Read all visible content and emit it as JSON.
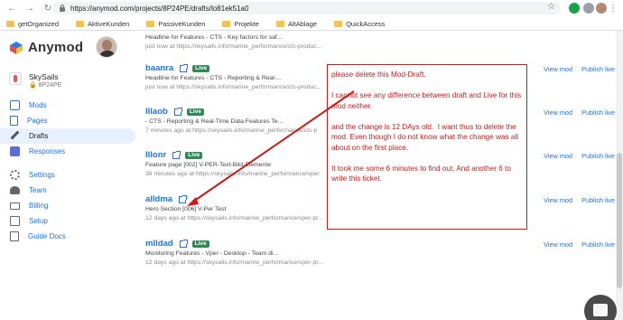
{
  "browser": {
    "url": "https://anymod.com/projects/8P24PE/drafts/lo81ek51a0",
    "bookmarks": [
      "getOrganized",
      "AktiveKunden",
      "PassiveKunden",
      "Projekte",
      "AltAblage",
      "QuickAccess"
    ]
  },
  "brand": {
    "name": "Anymod"
  },
  "project": {
    "name": "SkySails",
    "id": "8P24PE"
  },
  "menu": {
    "mods": "Mods",
    "pages": "Pages",
    "drafts": "Drafts",
    "responses": "Responses",
    "settings": "Settings",
    "team": "Team",
    "billing": "Billing",
    "setup": "Setup",
    "guide_docs": "Guide Docs"
  },
  "drafts": [
    {
      "name": "",
      "desc": "Headline for Features - CTS - Key factors for saf...",
      "meta": "just now at https://skysails.info/marine_performance/cts-produc...",
      "live": false
    },
    {
      "name": "baanra",
      "desc": "Headline for Features - CTS - Reporting & Real-...",
      "meta": "just now at https://skysails.info/marine_performance/cts-produc...",
      "live": true
    },
    {
      "name": "lllaob",
      "desc": "- CTS - Reporting & Real-Time Data Features Te...",
      "meta": "7 minutes ago at https://skysails.info/marine_performance/cts-p",
      "live": true
    },
    {
      "name": "lllonr",
      "desc": "Feature page [002] V-PER-Text-Bild-Elemente",
      "meta": "38 minutes ago at https://skysails.info/marine_performance/vper",
      "live": true
    },
    {
      "name": "alldma",
      "desc": "Hero Section [006] V-Per Test",
      "meta": "12 days ago at https://skysails.info/marine_performance/vper-pr...",
      "live": false
    },
    {
      "name": "mlldad",
      "desc": "Monitoring Features - Vper - Desktop - Team di...",
      "meta": "12 days ago at https://skysails.info/marine_performance/vper-pr...",
      "live": true
    }
  ],
  "actions": {
    "view": "View mod",
    "publish": "Publish live"
  },
  "badge_label": "Live",
  "annotation": {
    "text": "please delete this Mod-Draft.\n\nI cannot see any difference between draft and Live for this mod neither.\n\nand the change is 12 DAys old.  I want thus to delete the mod. Even though I do not know what the change was all about on the first place.\n\nIt took me some 6 minutes to find out. And another 6 to write this ticket."
  },
  "colors": {
    "accent": "#1a73e8",
    "live_badge": "#2e8b57",
    "annotation": "#c71a1a"
  }
}
